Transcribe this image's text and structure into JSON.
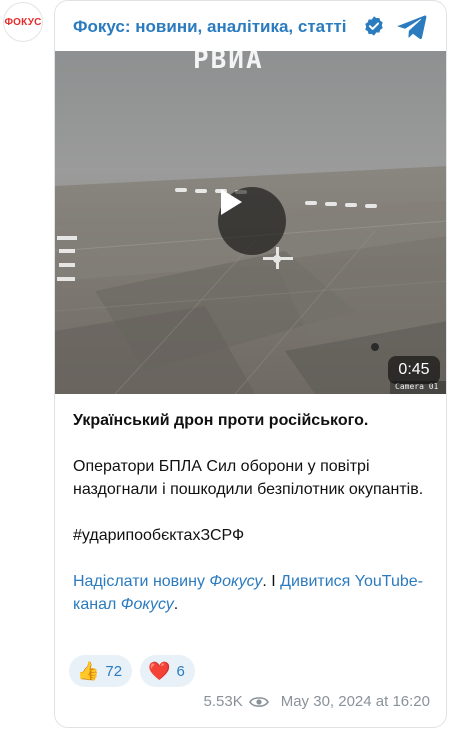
{
  "avatar": {
    "logo_text": "ФОКУС"
  },
  "header": {
    "channel_name": "Фокус: новини, аналітика, статті",
    "verified_icon": "verified-badge-icon",
    "telegram_icon": "telegram-icon"
  },
  "media": {
    "overlay_title": "РВИА",
    "duration": "0:45",
    "camera_label": "Camera 01",
    "play_icon": "play-icon"
  },
  "post": {
    "title": "Український дрон проти російського.",
    "body": "Оператори БПЛА Сил оборони у повітрі наздогнали і пошкодили безпілотник окупантів.",
    "hashtag": "#ударипообєктахЗСРФ",
    "link_part1": "Надіслати новину ",
    "link_part1_italic": "Фокусу",
    "separator": ". І ",
    "link_part2": "Дивитися YouTube-канал ",
    "link_part2_italic": "Фокусу",
    "link_end": "."
  },
  "reactions": [
    {
      "emoji": "👍",
      "count": "72"
    },
    {
      "emoji": "❤️",
      "count": "6"
    }
  ],
  "meta": {
    "views": "5.53K",
    "date": "May 30, 2024 at 16:20"
  },
  "colors": {
    "accent": "#2b7bbf",
    "logo_red": "#e52b2b"
  }
}
